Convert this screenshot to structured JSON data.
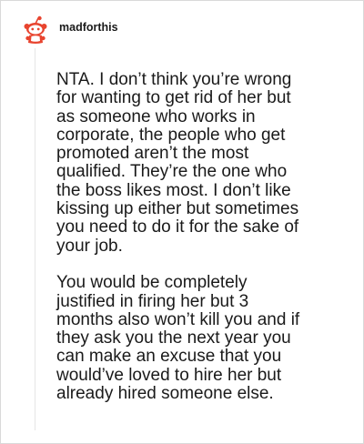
{
  "post": {
    "username": "madforthis",
    "avatar_icon": "reddit-snoo-avatar-icon",
    "paragraphs": [
      "NTA. I don’t think you’re wrong\nfor wanting to get rid of her but\nas someone who works in\ncorporate, the people who get\npromoted aren’t the most\nqualified. They’re the one who\nthe boss likes most. I don’t like\nkissing up either but sometimes\nyou need to do it for the sake of\nyour job.",
      "You would be completely\njustified in firing her but 3\nmonths also won’t kill you and if\nthey ask you the next year you\ncan make an excuse that you\nwould’ve loved to hire her but\nalready hired someone else."
    ]
  },
  "colors": {
    "text": "#1a1a1a",
    "border": "#d9d9d9",
    "thread_line": "#e6e6e6",
    "avatar_red": "#e8442f",
    "avatar_body": "#ffffff"
  }
}
